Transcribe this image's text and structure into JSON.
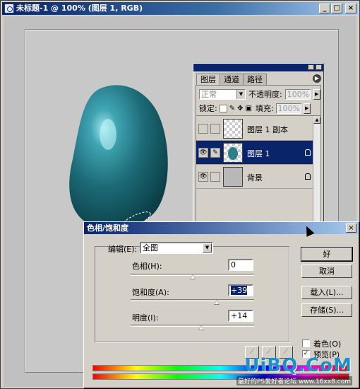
{
  "window": {
    "title": "未标题-1 @ 100% (图层 1, RGB)",
    "buttons": {
      "minimize": "_",
      "maximize": "□",
      "close": "×"
    }
  },
  "layers_panel": {
    "tabs": [
      "图层",
      "通道",
      "路径"
    ],
    "active_tab": "图层",
    "blend_mode": "正常",
    "opacity_label": "不透明度:",
    "opacity_value": "100%",
    "lock_label": "锁定:",
    "fill_label": "填充:",
    "fill_value": "100%",
    "layers": [
      {
        "name": "图层 1 副本",
        "visible": false,
        "selected": false
      },
      {
        "name": "图层 1",
        "visible": true,
        "selected": true
      },
      {
        "name": "背景",
        "visible": true,
        "selected": false
      }
    ]
  },
  "dialog": {
    "title": "色相/饱和度",
    "edit_label": "编辑(E):",
    "edit_value": "全图",
    "hue_label": "色相(H):",
    "hue_value": "0",
    "saturation_label": "饱和度(A):",
    "saturation_value": "+39",
    "lightness_label": "明度(I):",
    "lightness_value": "+14",
    "slider_levels": {
      "hue": 0,
      "saturation": 39,
      "lightness": 14
    },
    "buttons": {
      "ok": "好",
      "cancel": "取消",
      "load": "载入(L)...",
      "save": "存储(S)..."
    },
    "colorize_label": "着色(O)",
    "colorize_checked": false,
    "preview_label": "预览(P)",
    "preview_checked": true
  },
  "watermark": {
    "logo": "UiBQ.CoM",
    "sub": "最好的PS爱好者论坛 www.16xx8.com"
  },
  "colors": {
    "title_active": "#0a246a",
    "blob": "#2a7f8a",
    "face": "#d4d0c8"
  },
  "icons": [
    "photoshop-icon",
    "eye-icon",
    "brush-icon",
    "lock-icon",
    "eyedropper-icon",
    "panel-menu-icon",
    "dropdown-arrow-icon"
  ]
}
